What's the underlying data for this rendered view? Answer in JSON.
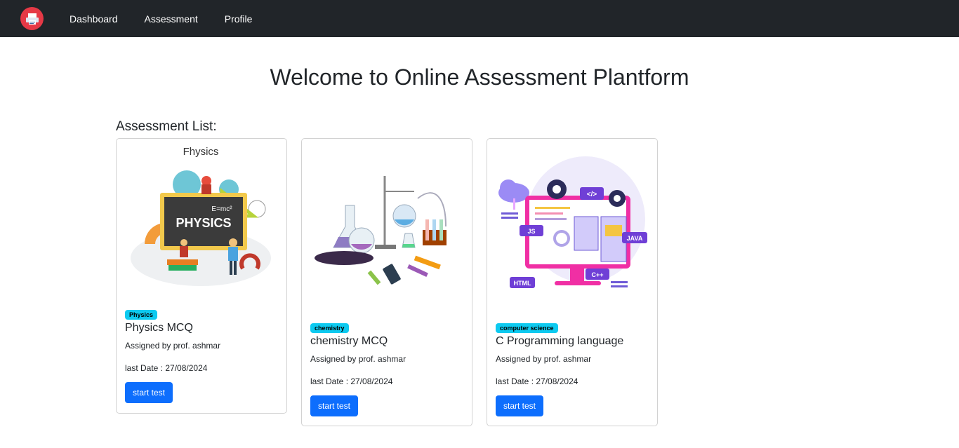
{
  "nav": {
    "items": [
      {
        "label": "Dashboard"
      },
      {
        "label": "Assessment"
      },
      {
        "label": "Profile"
      }
    ]
  },
  "main": {
    "title": "Welcome to Online Assessment Plantform",
    "list_heading": "Assessment List:"
  },
  "cards": [
    {
      "image_caption": "Fhysics",
      "image_board_text": "PHYSICS",
      "image_formula": "E=mc²",
      "badge": "Physics",
      "title": "Physics MCQ",
      "assigned": "Assigned by prof. ashmar",
      "last_date": "last Date : 27/08/2024",
      "button": "start test"
    },
    {
      "badge": "chemistry",
      "title": "chemistry MCQ",
      "assigned": "Assigned by prof. ashmar",
      "last_date": "last Date : 27/08/2024",
      "button": "start test"
    },
    {
      "image_labels": {
        "js": "JS",
        "java": "JAVA",
        "html": "HTML",
        "cpp": "C++",
        "code": "</>"
      },
      "badge": "computer science",
      "title": "C Programming language",
      "assigned": "Assigned by prof. ashmar",
      "last_date": "last Date : 27/08/2024",
      "button": "start test"
    }
  ],
  "colors": {
    "navbar": "#212529",
    "badge": "#0dcaf0",
    "button": "#0d6efd",
    "logo": "#e63946"
  }
}
